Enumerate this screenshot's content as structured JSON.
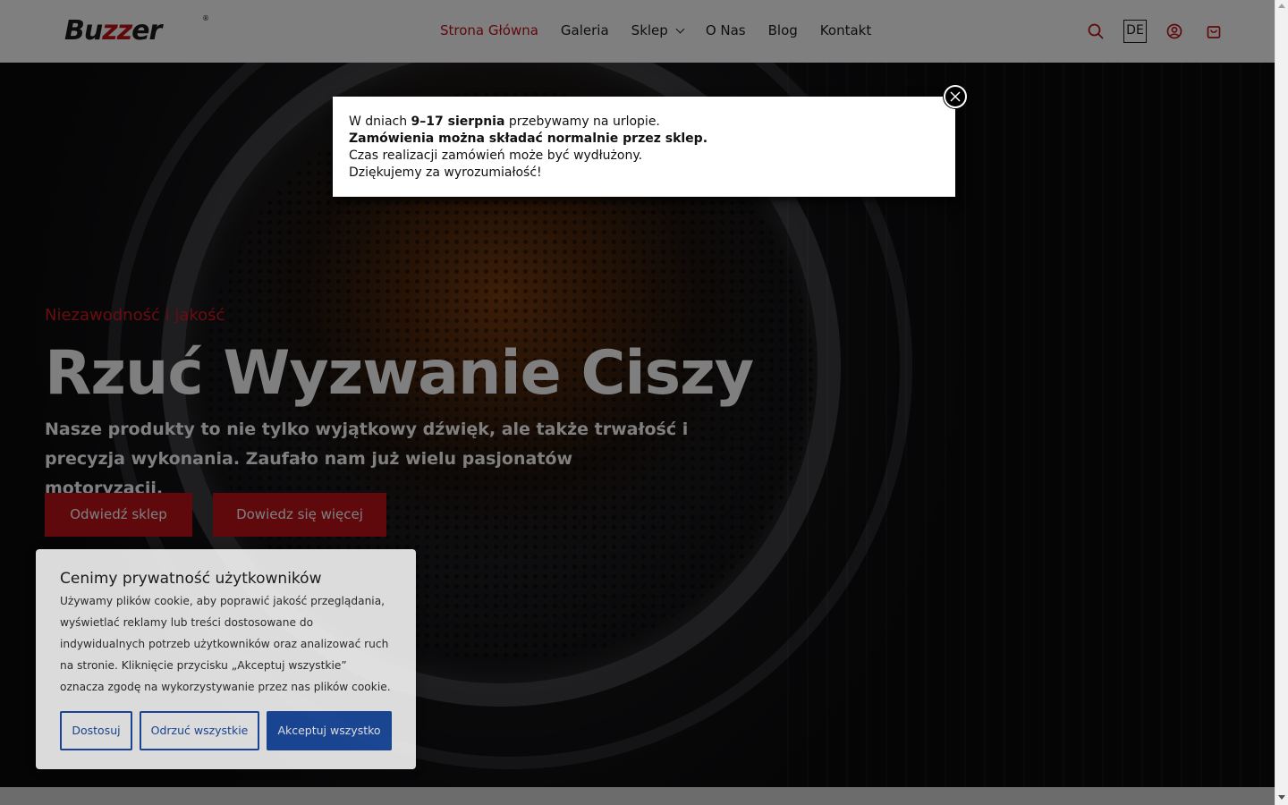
{
  "header": {
    "logo": {
      "text_a": "Bu",
      "text_b": "zz",
      "text_c": "er",
      "reg": "®"
    },
    "nav": [
      {
        "label": "Strona Główna",
        "active": true
      },
      {
        "label": "Galeria"
      },
      {
        "label": "Sklep",
        "has_dropdown": true
      },
      {
        "label": "O Nas"
      },
      {
        "label": "Blog"
      },
      {
        "label": "Kontakt"
      }
    ],
    "icons": [
      "search-icon",
      "account-icon",
      "cart-icon"
    ],
    "language": "DE"
  },
  "hero": {
    "tagline": "Niezawodność i jakość",
    "title": "Rzuć Wyzwanie Ciszy",
    "subtitle": "Nasze produkty to nie tylko wyjątkowy dźwięk, ale także trwałość i precyzja wykonania. Zaufało nam już wielu pasjonatów motoryzacji.",
    "buttons": {
      "shop": "Odwiedź sklep",
      "more": "Dowiedz się więcej"
    }
  },
  "popup": {
    "line1_pre": "W dniach ",
    "line1_bold": "9–17 sierpnia",
    "line1_post": " przebywamy na urlopie.",
    "line2": "Zamówienia można składać normalnie przez sklep.",
    "line3": "Czas realizacji zamówień może być wydłużony.",
    "line4": "Dziękujemy za wyrozumiałość!"
  },
  "cookie": {
    "title": "Cenimy prywatność użytkowników",
    "text": "Używamy plików cookie, aby poprawić jakość przeglądania, wyświetlać reklamy lub treści dostosowane do indywidualnych potrzeb użytkowników oraz analizować ruch na stronie. Kliknięcie przycisku „Akceptuj wszystkie” oznacza zgodę na wykorzystywanie przez nas plików cookie.",
    "buttons": {
      "customize": "Dostosuj",
      "reject": "Odrzuć wszystkie",
      "accept": "Akceptuj wszystko"
    }
  },
  "colors": {
    "brand_red": "#c0121a",
    "cookie_blue": "#1c4fa8"
  }
}
